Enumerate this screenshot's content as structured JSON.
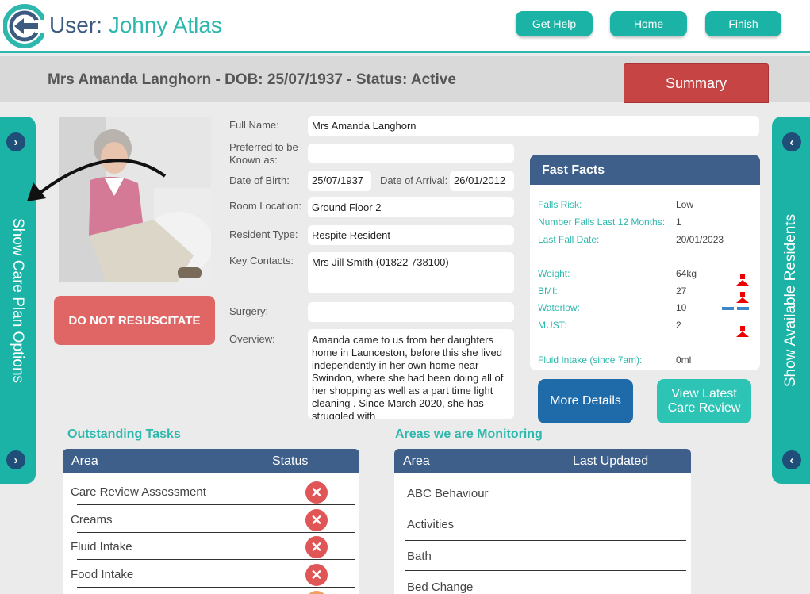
{
  "header": {
    "user_prefix": "User:",
    "user_name": "Johny Atlas",
    "help_label": "Get Help",
    "home_label": "Home",
    "finish_label": "Finish",
    "accent": "#2eb8ad"
  },
  "resident": {
    "title": "Mrs Amanda Langhorn - DOB: 25/07/1937 - Status: Active",
    "summary_label": "Summary",
    "dnr_label": "DO NOT RESUSCITATE"
  },
  "side": {
    "left_label": "Show Care Plan Options",
    "right_label": "Show Available Residents"
  },
  "form": {
    "full_name_label": "Full Name:",
    "full_name": "Mrs Amanda Langhorn",
    "preferred_label": "Preferred to be Known as:",
    "preferred": "",
    "dob_label": "Date of Birth:",
    "dob": "25/07/1937",
    "arrival_label": "Date of Arrival:",
    "arrival": "26/01/2012",
    "room_label": "Room Location:",
    "room": "Ground Floor 2",
    "type_label": "Resident Type:",
    "type": "Respite Resident",
    "contacts_label": "Key Contacts:",
    "contacts": "Mrs Jill Smith (01822 738100)",
    "surgery_label": "Surgery:",
    "surgery": "",
    "overview_label": "Overview:",
    "overview": "Amanda came to us from her daughters home in Launceston, before this she lived independently in her own home near Swindon, where she had been doing all of her shopping as well as a part time light cleaning . Since March 2020, she has struggled with"
  },
  "fast_facts": {
    "title": "Fast Facts",
    "rows": [
      {
        "label": "Falls Risk:",
        "value": "Low"
      },
      {
        "label": "Number Falls Last 12 Months:",
        "value": "1"
      },
      {
        "label": "Last Fall Date:",
        "value": "20/01/2023"
      },
      {
        "label": "Weight:",
        "value": "64kg",
        "indicator": "up"
      },
      {
        "label": "BMI:",
        "value": "27",
        "indicator": "up"
      },
      {
        "label": "Waterlow:",
        "value": "10",
        "indicator": "flat"
      },
      {
        "label": "MUST:",
        "value": "2",
        "indicator": "up"
      },
      {
        "label": "Fluid Intake (since 7am):",
        "value": "0ml"
      }
    ]
  },
  "actions": {
    "more_label": "More Details",
    "review_label": "View Latest Care Review"
  },
  "tasks": {
    "title": "Outstanding Tasks",
    "col_area": "Area",
    "col_status": "Status",
    "rows": [
      "Care Review Assessment",
      "Creams",
      "Fluid Intake",
      "Food Intake"
    ]
  },
  "monitoring": {
    "title": "Areas we are Monitoring",
    "col_area": "Area",
    "col_updated": "Last Updated",
    "rows": [
      "ABC Behaviour",
      "Activities",
      "Bath",
      "Bed Change"
    ]
  }
}
